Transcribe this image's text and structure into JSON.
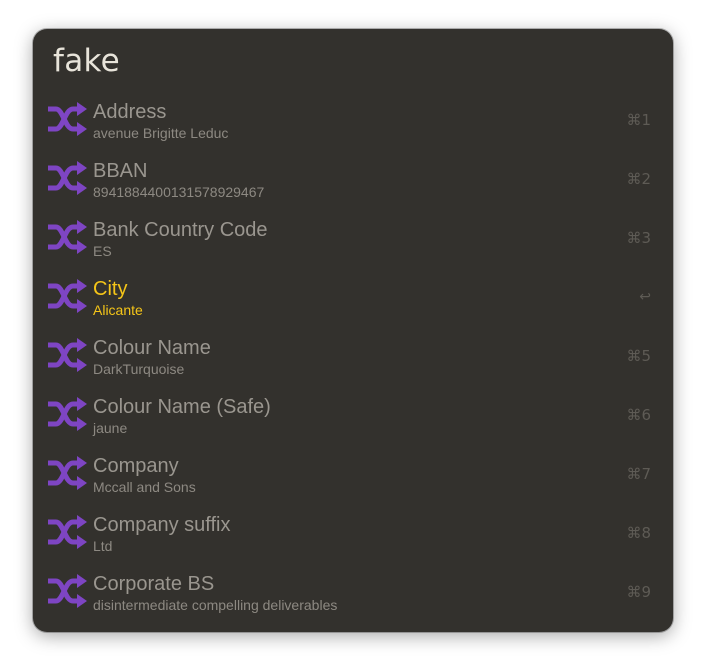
{
  "query": "fake",
  "accent_color": "#f5c518",
  "icon_color": "#7e45c3",
  "icon_name": "shuffle-icon",
  "results": [
    {
      "title": "Address",
      "subtitle": "avenue Brigitte Leduc",
      "shortcut": "⌘1"
    },
    {
      "title": "BBAN",
      "subtitle": "8941884400131578929467",
      "shortcut": "⌘2"
    },
    {
      "title": "Bank Country Code",
      "subtitle": "ES",
      "shortcut": "⌘3"
    },
    {
      "title": "City",
      "subtitle": "Alicante",
      "shortcut": "↩"
    },
    {
      "title": "Colour Name",
      "subtitle": "DarkTurquoise",
      "shortcut": "⌘5"
    },
    {
      "title": "Colour Name (Safe)",
      "subtitle": "jaune",
      "shortcut": "⌘6"
    },
    {
      "title": "Company",
      "subtitle": "Mccall and Sons",
      "shortcut": "⌘7"
    },
    {
      "title": "Company suffix",
      "subtitle": "Ltd",
      "shortcut": "⌘8"
    },
    {
      "title": "Corporate BS",
      "subtitle": "disintermediate compelling deliverables",
      "shortcut": "⌘9"
    }
  ]
}
